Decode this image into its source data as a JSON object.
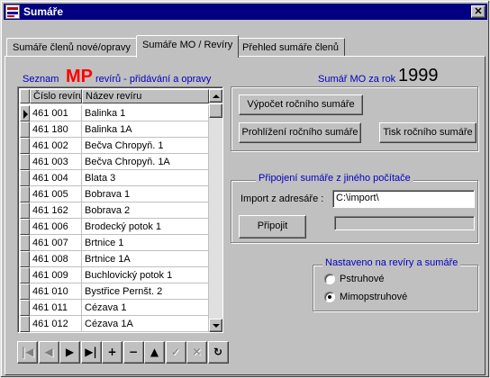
{
  "window": {
    "title": "Sumáře",
    "close_glyph": "✕"
  },
  "tabs": [
    {
      "label": "Sumáře členů nové/opravy",
      "active": false
    },
    {
      "label": "Sumáře MO / Revíry",
      "active": true
    },
    {
      "label": "Přehled sumáře členů",
      "active": false
    }
  ],
  "list_header": {
    "prefix": "Seznam",
    "code": "MP",
    "suffix": "revírů -  přidávání a opravy"
  },
  "year_header": {
    "caption": "Sumář MO za rok",
    "year": "1999"
  },
  "grid": {
    "columns": [
      "Číslo revíru",
      "Název revíru"
    ],
    "current_row": 0,
    "rows": [
      [
        "461 001",
        "Balinka 1"
      ],
      [
        "461 180",
        "Balinka 1A"
      ],
      [
        "461 002",
        "Bečva Chropyň. 1"
      ],
      [
        "461 003",
        "Bečva Chropyň. 1A"
      ],
      [
        "461 004",
        "Blata 3"
      ],
      [
        "461 005",
        "Bobrava 1"
      ],
      [
        "461 162",
        "Bobrava 2"
      ],
      [
        "461 006",
        "Brodecký potok 1"
      ],
      [
        "461 007",
        "Brtnice 1"
      ],
      [
        "461 008",
        "Brtnice 1A"
      ],
      [
        "461 009",
        "Buchlovický potok 1"
      ],
      [
        "461 010",
        "Bystřice Pernšt. 2"
      ],
      [
        "461 011",
        "Cézava 1"
      ],
      [
        "461 012",
        "Cézava 1A"
      ]
    ]
  },
  "navigator": [
    {
      "name": "nav-first-button",
      "glyph": "|◀",
      "enabled": false
    },
    {
      "name": "nav-prior-button",
      "glyph": "◀",
      "enabled": false
    },
    {
      "name": "nav-next-button",
      "glyph": "▶",
      "enabled": true
    },
    {
      "name": "nav-last-button",
      "glyph": "▶|",
      "enabled": true
    },
    {
      "name": "nav-insert-button",
      "glyph": "+",
      "enabled": true
    },
    {
      "name": "nav-delete-button",
      "glyph": "−",
      "enabled": true
    },
    {
      "name": "nav-edit-button",
      "glyph": "▲",
      "enabled": true
    },
    {
      "name": "nav-post-button",
      "glyph": "✓",
      "enabled": false
    },
    {
      "name": "nav-cancel-button",
      "glyph": "✕",
      "enabled": false
    },
    {
      "name": "nav-refresh-button",
      "glyph": "↻",
      "enabled": true
    }
  ],
  "actions": {
    "calculate": "Výpočet ročního sumáře",
    "browse": "Prohlížení ročního sumáře",
    "print": "Tisk ročního sumáře"
  },
  "import_group": {
    "title": "Připojení sumáře z jiného počítače",
    "label": "Import z adresáře :",
    "value": "C:\\import\\",
    "connect": "Připojit",
    "progress": 0
  },
  "mode_group": {
    "title": "Nastaveno na revíry a sumáře",
    "options": [
      {
        "label": "Pstruhové",
        "selected": false
      },
      {
        "label": "Mimopstruhové",
        "selected": true
      }
    ]
  }
}
